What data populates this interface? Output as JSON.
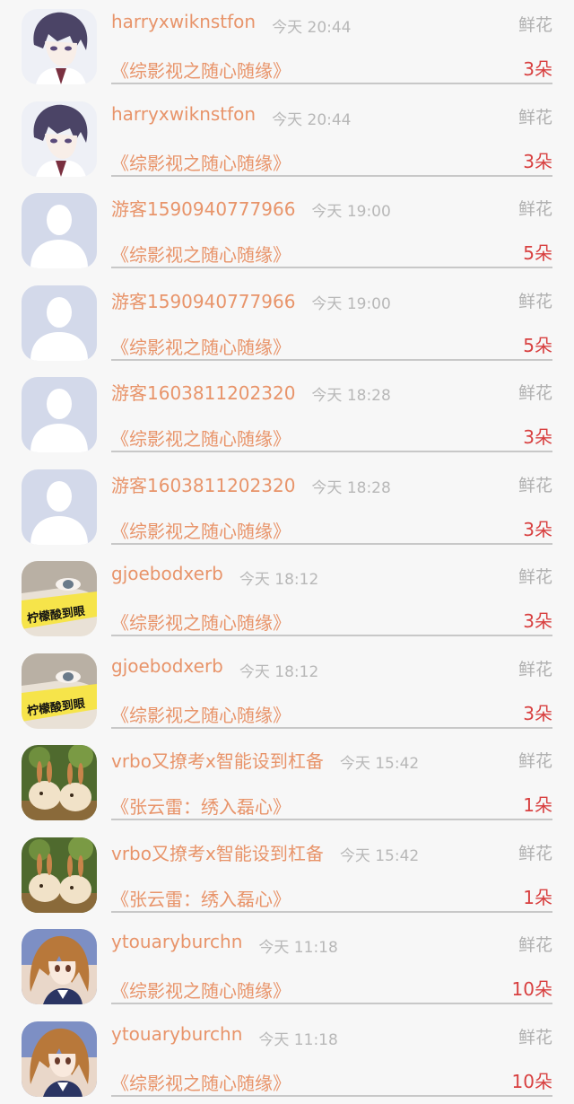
{
  "records": [
    {
      "avatar": "anime-boy-avatar",
      "username": "harryxwiknstfon",
      "time": "今天 20:44",
      "gift_type": "鲜花",
      "title": "《综影视之随心随缘》",
      "count": "3朵"
    },
    {
      "avatar": "anime-boy-avatar",
      "username": "harryxwiknstfon",
      "time": "今天 20:44",
      "gift_type": "鲜花",
      "title": "《综影视之随心随缘》",
      "count": "3朵"
    },
    {
      "avatar": "default-user-avatar",
      "username": "游客1590940777966",
      "time": "今天 19:00",
      "gift_type": "鲜花",
      "title": "《综影视之随心随缘》",
      "count": "5朵"
    },
    {
      "avatar": "default-user-avatar",
      "username": "游客1590940777966",
      "time": "今天 19:00",
      "gift_type": "鲜花",
      "title": "《综影视之随心随缘》",
      "count": "5朵"
    },
    {
      "avatar": "default-user-avatar",
      "username": "游客1603811202320",
      "time": "今天 18:28",
      "gift_type": "鲜花",
      "title": "《综影视之随心随缘》",
      "count": "3朵"
    },
    {
      "avatar": "default-user-avatar",
      "username": "游客1603811202320",
      "time": "今天 18:28",
      "gift_type": "鲜花",
      "title": "《综影视之随心随缘》",
      "count": "3朵"
    },
    {
      "avatar": "lemon-girl-avatar",
      "username": "gjoebodxerb",
      "time": "今天 18:12",
      "gift_type": "鲜花",
      "title": "《综影视之随心随缘》",
      "count": "3朵"
    },
    {
      "avatar": "lemon-girl-avatar",
      "username": "gjoebodxerb",
      "time": "今天 18:12",
      "gift_type": "鲜花",
      "title": "《综影视之随心随缘》",
      "count": "3朵"
    },
    {
      "avatar": "bunny-buns-avatar",
      "username": "vrbo又撩考x智能设到杠备",
      "time": "今天 15:42",
      "gift_type": "鲜花",
      "title": "《张云雷：绣入磊心》",
      "count": "1朵"
    },
    {
      "avatar": "bunny-buns-avatar",
      "username": "vrbo又撩考x智能设到杠备",
      "time": "今天 15:42",
      "gift_type": "鲜花",
      "title": "《张云雷：绣入磊心》",
      "count": "1朵"
    },
    {
      "avatar": "anime-girl-avatar",
      "username": "ytouaryburchn",
      "time": "今天 11:18",
      "gift_type": "鲜花",
      "title": "《综影视之随心随缘》",
      "count": "10朵"
    },
    {
      "avatar": "anime-girl-avatar",
      "username": "ytouaryburchn",
      "time": "今天 11:18",
      "gift_type": "鲜花",
      "title": "《综影视之随心随缘》",
      "count": "10朵"
    }
  ],
  "avatar_lettering": {
    "lemon-girl-avatar": "柠檬酸到眼"
  },
  "colors": {
    "username": "#e8946a",
    "time": "#b8b8b8",
    "gift_type": "#b0b0b0",
    "count": "#d84040",
    "background": "#f7f7f7"
  }
}
